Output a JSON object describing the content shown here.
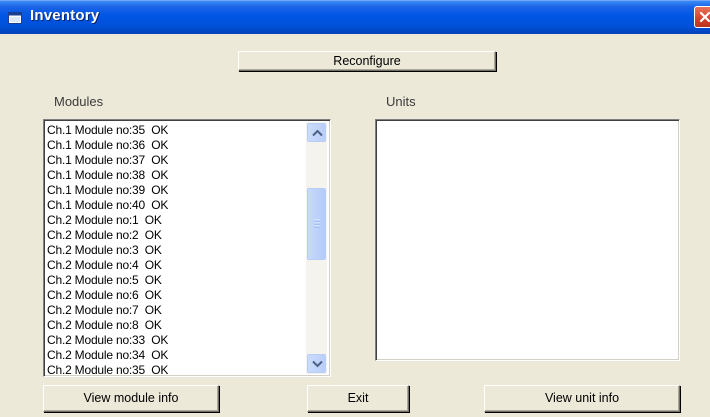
{
  "window": {
    "title": "Inventory",
    "colors": {
      "titlebar": "#0055e5",
      "face": "#ece9d8",
      "close": "#d2422a"
    },
    "icons": {
      "title": "window-app-icon",
      "close": "close-icon"
    }
  },
  "toolbar": {
    "reconfigure_label": "Reconfigure"
  },
  "modules": {
    "label": "Modules",
    "items": [
      "Ch.1 Module no:35  OK",
      "Ch.1 Module no:36  OK",
      "Ch.1 Module no:37  OK",
      "Ch.1 Module no:38  OK",
      "Ch.1 Module no:39  OK",
      "Ch.1 Module no:40  OK",
      "Ch.2 Module no:1  OK",
      "Ch.2 Module no:2  OK",
      "Ch.2 Module no:3  OK",
      "Ch.2 Module no:4  OK",
      "Ch.2 Module no:5  OK",
      "Ch.2 Module no:6  OK",
      "Ch.2 Module no:7  OK",
      "Ch.2 Module no:8  OK",
      "Ch.2 Module no:33  OK",
      "Ch.2 Module no:34  OK",
      "Ch.2 Module no:35  OK"
    ],
    "scrollbar_icons": {
      "up": "chevron-up-icon",
      "down": "chevron-down-icon"
    }
  },
  "units": {
    "label": "Units",
    "items": []
  },
  "footer": {
    "view_module_label": "View module info",
    "exit_label": "Exit",
    "view_unit_label": "View unit info"
  }
}
